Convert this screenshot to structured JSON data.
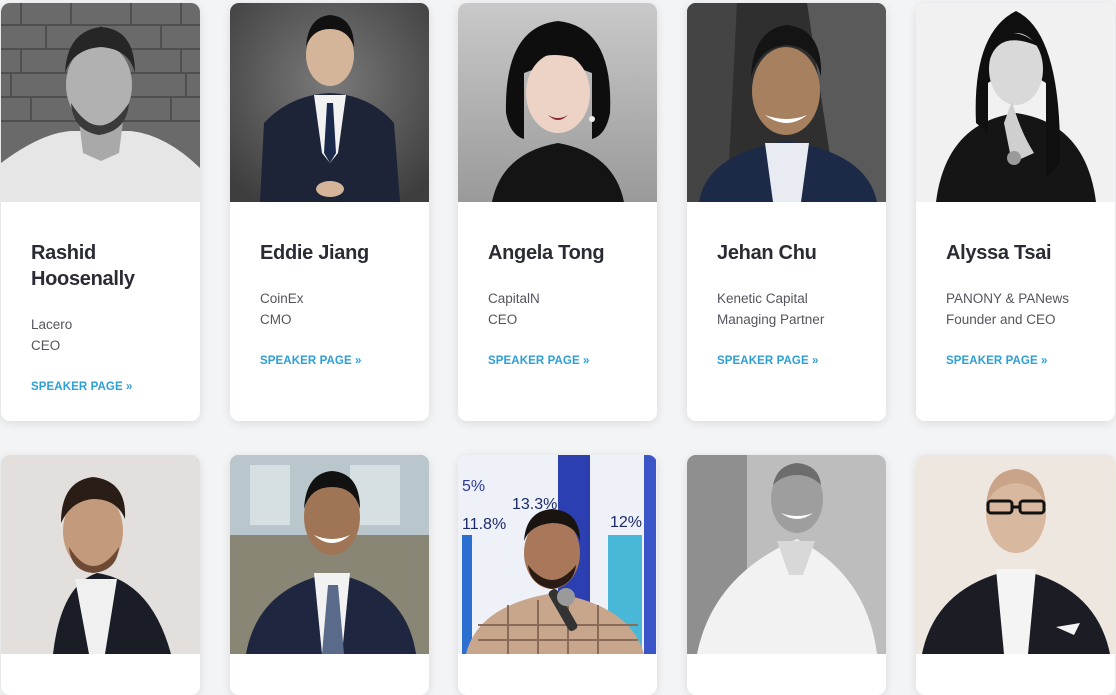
{
  "speakers": [
    {
      "name": "Rashid Hoosenally",
      "org": "Lacero",
      "role": "CEO",
      "link": "SPEAKER PAGE »"
    },
    {
      "name": "Eddie Jiang",
      "org": "CoinEx",
      "role": "CMO",
      "link": "SPEAKER PAGE »"
    },
    {
      "name": "Angela Tong",
      "org": "CapitalN",
      "role": "CEO",
      "link": "SPEAKER PAGE »"
    },
    {
      "name": "Jehan Chu",
      "org": "Kenetic Capital",
      "role": "Managing Partner",
      "link": "SPEAKER PAGE »"
    },
    {
      "name": "Alyssa Tsai",
      "org": "PANONY & PANews",
      "role": "Founder and CEO",
      "link": "SPEAKER PAGE »"
    }
  ],
  "second_row_photo_text": {
    "left_pct": "5%",
    "mid": "13.3%",
    "low": "11.8%",
    "right": "12%"
  },
  "colors": {
    "link": "#2d9fd7",
    "name": "#2b2b35",
    "page_bg": "#f3f4f6"
  }
}
